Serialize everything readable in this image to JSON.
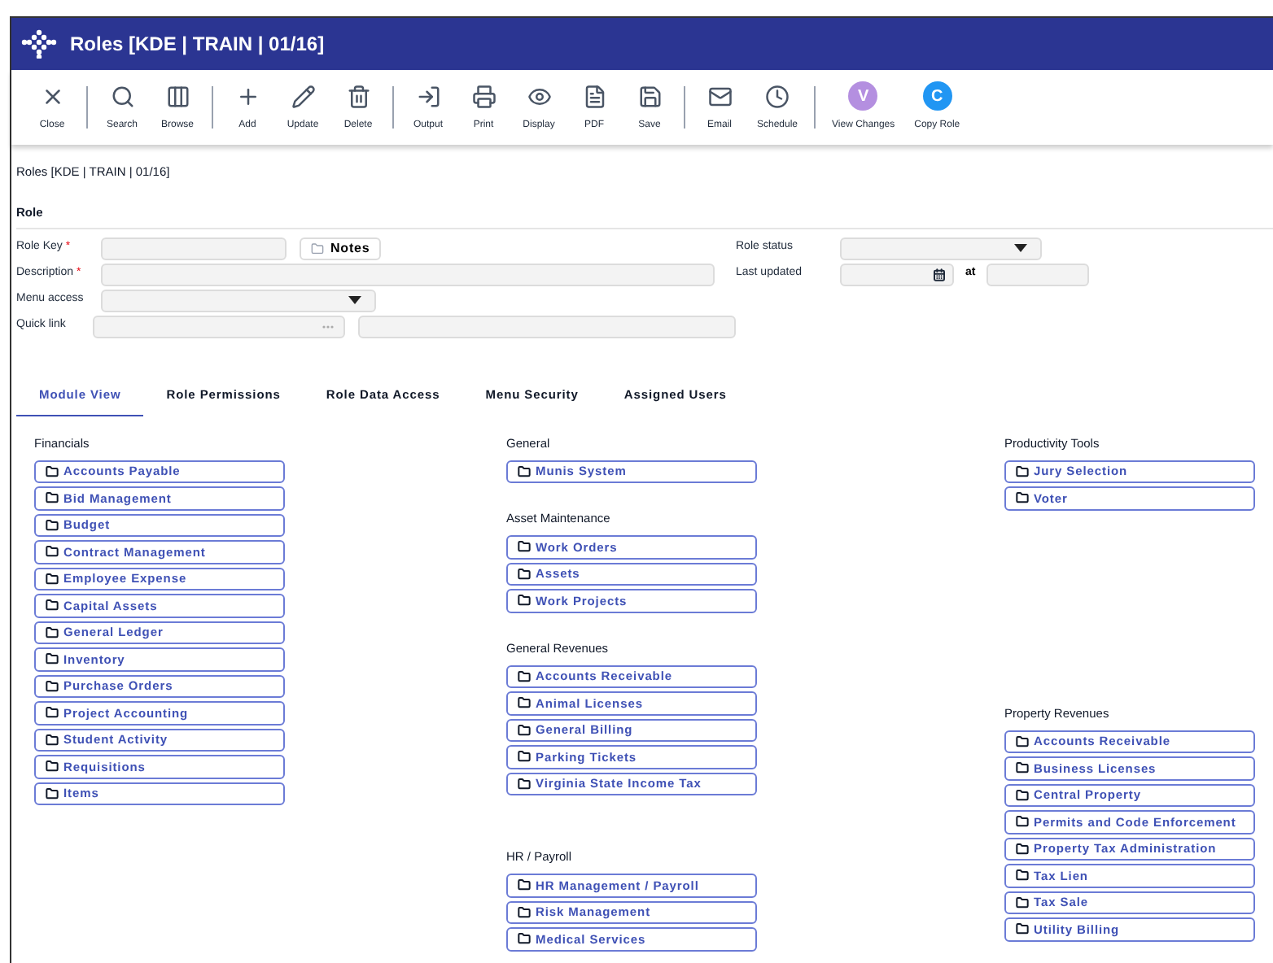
{
  "window": {
    "title": "Roles [KDE | TRAIN | 01/16]"
  },
  "toolbar_groups": [
    [
      {
        "kind": "close",
        "label": "Close"
      }
    ],
    [
      {
        "kind": "search",
        "label": "Search"
      },
      {
        "kind": "browse",
        "label": "Browse"
      }
    ],
    [
      {
        "kind": "add",
        "label": "Add"
      },
      {
        "kind": "update",
        "label": "Update"
      },
      {
        "kind": "delete",
        "label": "Delete"
      }
    ],
    [
      {
        "kind": "output",
        "label": "Output"
      },
      {
        "kind": "print",
        "label": "Print"
      },
      {
        "kind": "display",
        "label": "Display"
      },
      {
        "kind": "pdf",
        "label": "PDF"
      },
      {
        "kind": "save",
        "label": "Save"
      }
    ],
    [
      {
        "kind": "email",
        "label": "Email"
      },
      {
        "kind": "schedule",
        "label": "Schedule"
      }
    ],
    [
      {
        "kind": "badge",
        "letter": "V",
        "color": "#b48fe0",
        "label": "View Changes"
      },
      {
        "kind": "badge",
        "letter": "C",
        "color": "#2196f3",
        "label": "Copy Role"
      }
    ]
  ],
  "breadcrumb": "Roles [KDE | TRAIN | 01/16]",
  "section_title": "Role",
  "form": {
    "role_key": {
      "label": "Role Key",
      "required_mark": "*"
    },
    "notes_button": "Notes",
    "description": {
      "label": "Description",
      "required_mark": "*"
    },
    "menu_access": {
      "label": "Menu access"
    },
    "quick_link": {
      "label": "Quick link"
    },
    "role_status": {
      "label": "Role status"
    },
    "last_updated": {
      "label": "Last updated",
      "at_label": "at"
    }
  },
  "tabs": [
    {
      "label": "Module View",
      "selected": true
    },
    {
      "label": "Role Permissions",
      "selected": false
    },
    {
      "label": "Role Data Access",
      "selected": false
    },
    {
      "label": "Menu Security",
      "selected": false
    },
    {
      "label": "Assigned Users",
      "selected": false
    }
  ],
  "columns": [
    [
      {
        "title": "Financials",
        "items": [
          "Accounts Payable",
          "Bid Management",
          "Budget",
          "Contract Management",
          "Employee Expense",
          "Capital Assets",
          "General Ledger",
          "Inventory",
          "Purchase Orders",
          "Project Accounting",
          "Student Activity",
          "Requisitions",
          "Items"
        ]
      }
    ],
    [
      {
        "title": "General",
        "items": [
          "Munis System"
        ]
      },
      {
        "title": "Asset Maintenance",
        "items": [
          "Work Orders",
          "Assets",
          "Work Projects"
        ]
      },
      {
        "title": "General Revenues",
        "items": [
          "Accounts Receivable",
          "Animal Licenses",
          "General Billing",
          "Parking Tickets",
          "Virginia State Income Tax"
        ]
      },
      {
        "title": "HR / Payroll",
        "items": [
          "HR Management / Payroll",
          "Risk Management",
          "Medical Services"
        ]
      }
    ],
    [
      {
        "title": "Productivity Tools",
        "items": [
          "Jury Selection",
          "Voter"
        ]
      },
      {
        "title": "Property Revenues",
        "items": [
          "Accounts Receivable",
          "Business Licenses",
          "Central Property",
          "Permits and Code Enforcement",
          "Property Tax Administration",
          "Tax Lien",
          "Tax Sale",
          "Utility Billing"
        ]
      }
    ]
  ]
}
